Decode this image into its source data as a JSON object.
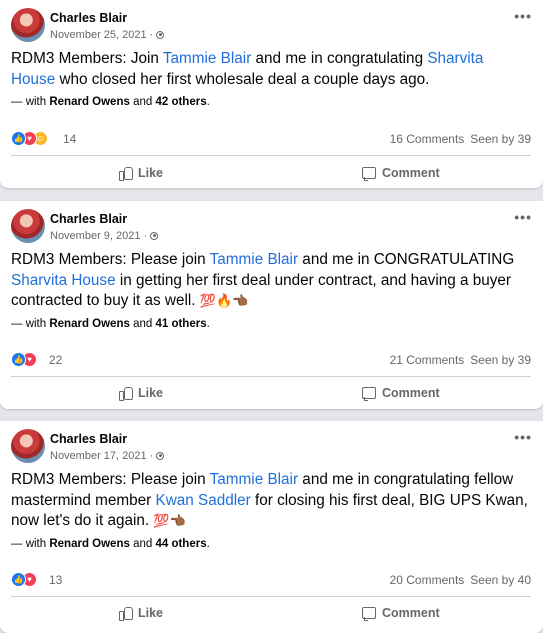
{
  "posts": [
    {
      "author": "Charles Blair",
      "date": "November 25, 2021 ·",
      "text_before": "RDM3 Members: Join ",
      "mention1": "Tammie Blair",
      "text_mid": " and me in congratulating ",
      "mention2": "Sharvita House",
      "text_after": " who closed her first wholesale deal a couple days ago.",
      "emojis": "",
      "with_prefix": "— with ",
      "with_name": "Renard Owens",
      "with_and": " and ",
      "with_others": "42 others",
      "with_end": ".",
      "reactions": [
        "like",
        "love",
        "care"
      ],
      "reaction_count": "14",
      "comments": "16 Comments",
      "seen": "Seen by 39",
      "like_label": "Like",
      "comment_label": "Comment"
    },
    {
      "author": "Charles Blair",
      "date": "November 9, 2021 ·",
      "text_before": "RDM3 Members: Please join ",
      "mention1": "Tammie Blair",
      "text_mid": " and me in CONGRATULATING ",
      "mention2": "Sharvita House",
      "text_after": " in getting her first deal under contract, and having a buyer contracted to buy it as well. ",
      "emojis": "💯🔥👈🏾",
      "with_prefix": "— with ",
      "with_name": "Renard Owens",
      "with_and": " and ",
      "with_others": "41 others",
      "with_end": ".",
      "reactions": [
        "like",
        "love"
      ],
      "reaction_count": "22",
      "comments": "21 Comments",
      "seen": "Seen by 39",
      "like_label": "Like",
      "comment_label": "Comment"
    },
    {
      "author": "Charles Blair",
      "date": "November 17, 2021 ·",
      "text_before": "RDM3 Members: Please join ",
      "mention1": "Tammie Blair",
      "text_mid": " and me in congratulating fellow mastermind member ",
      "mention2": "Kwan Saddler",
      "text_after": " for closing his first deal, BIG UPS Kwan, now let's do it again. ",
      "emojis": "💯👈🏾",
      "with_prefix": "— with ",
      "with_name": "Renard Owens",
      "with_and": " and ",
      "with_others": "44 others",
      "with_end": ".",
      "reactions": [
        "like",
        "love"
      ],
      "reaction_count": "13",
      "comments": "20 Comments",
      "seen": "Seen by 40",
      "like_label": "Like",
      "comment_label": "Comment"
    }
  ],
  "icons": {
    "more": "more-options-icon",
    "privacy": "globe-icon",
    "like": "thumbs-up-icon",
    "comment": "comment-bubble-icon"
  },
  "colors": {
    "link": "#216fdb",
    "like_reaction": "#1877f2",
    "love_reaction": "#f33e58",
    "care_reaction": "#f7b928",
    "muted": "#65676b"
  }
}
